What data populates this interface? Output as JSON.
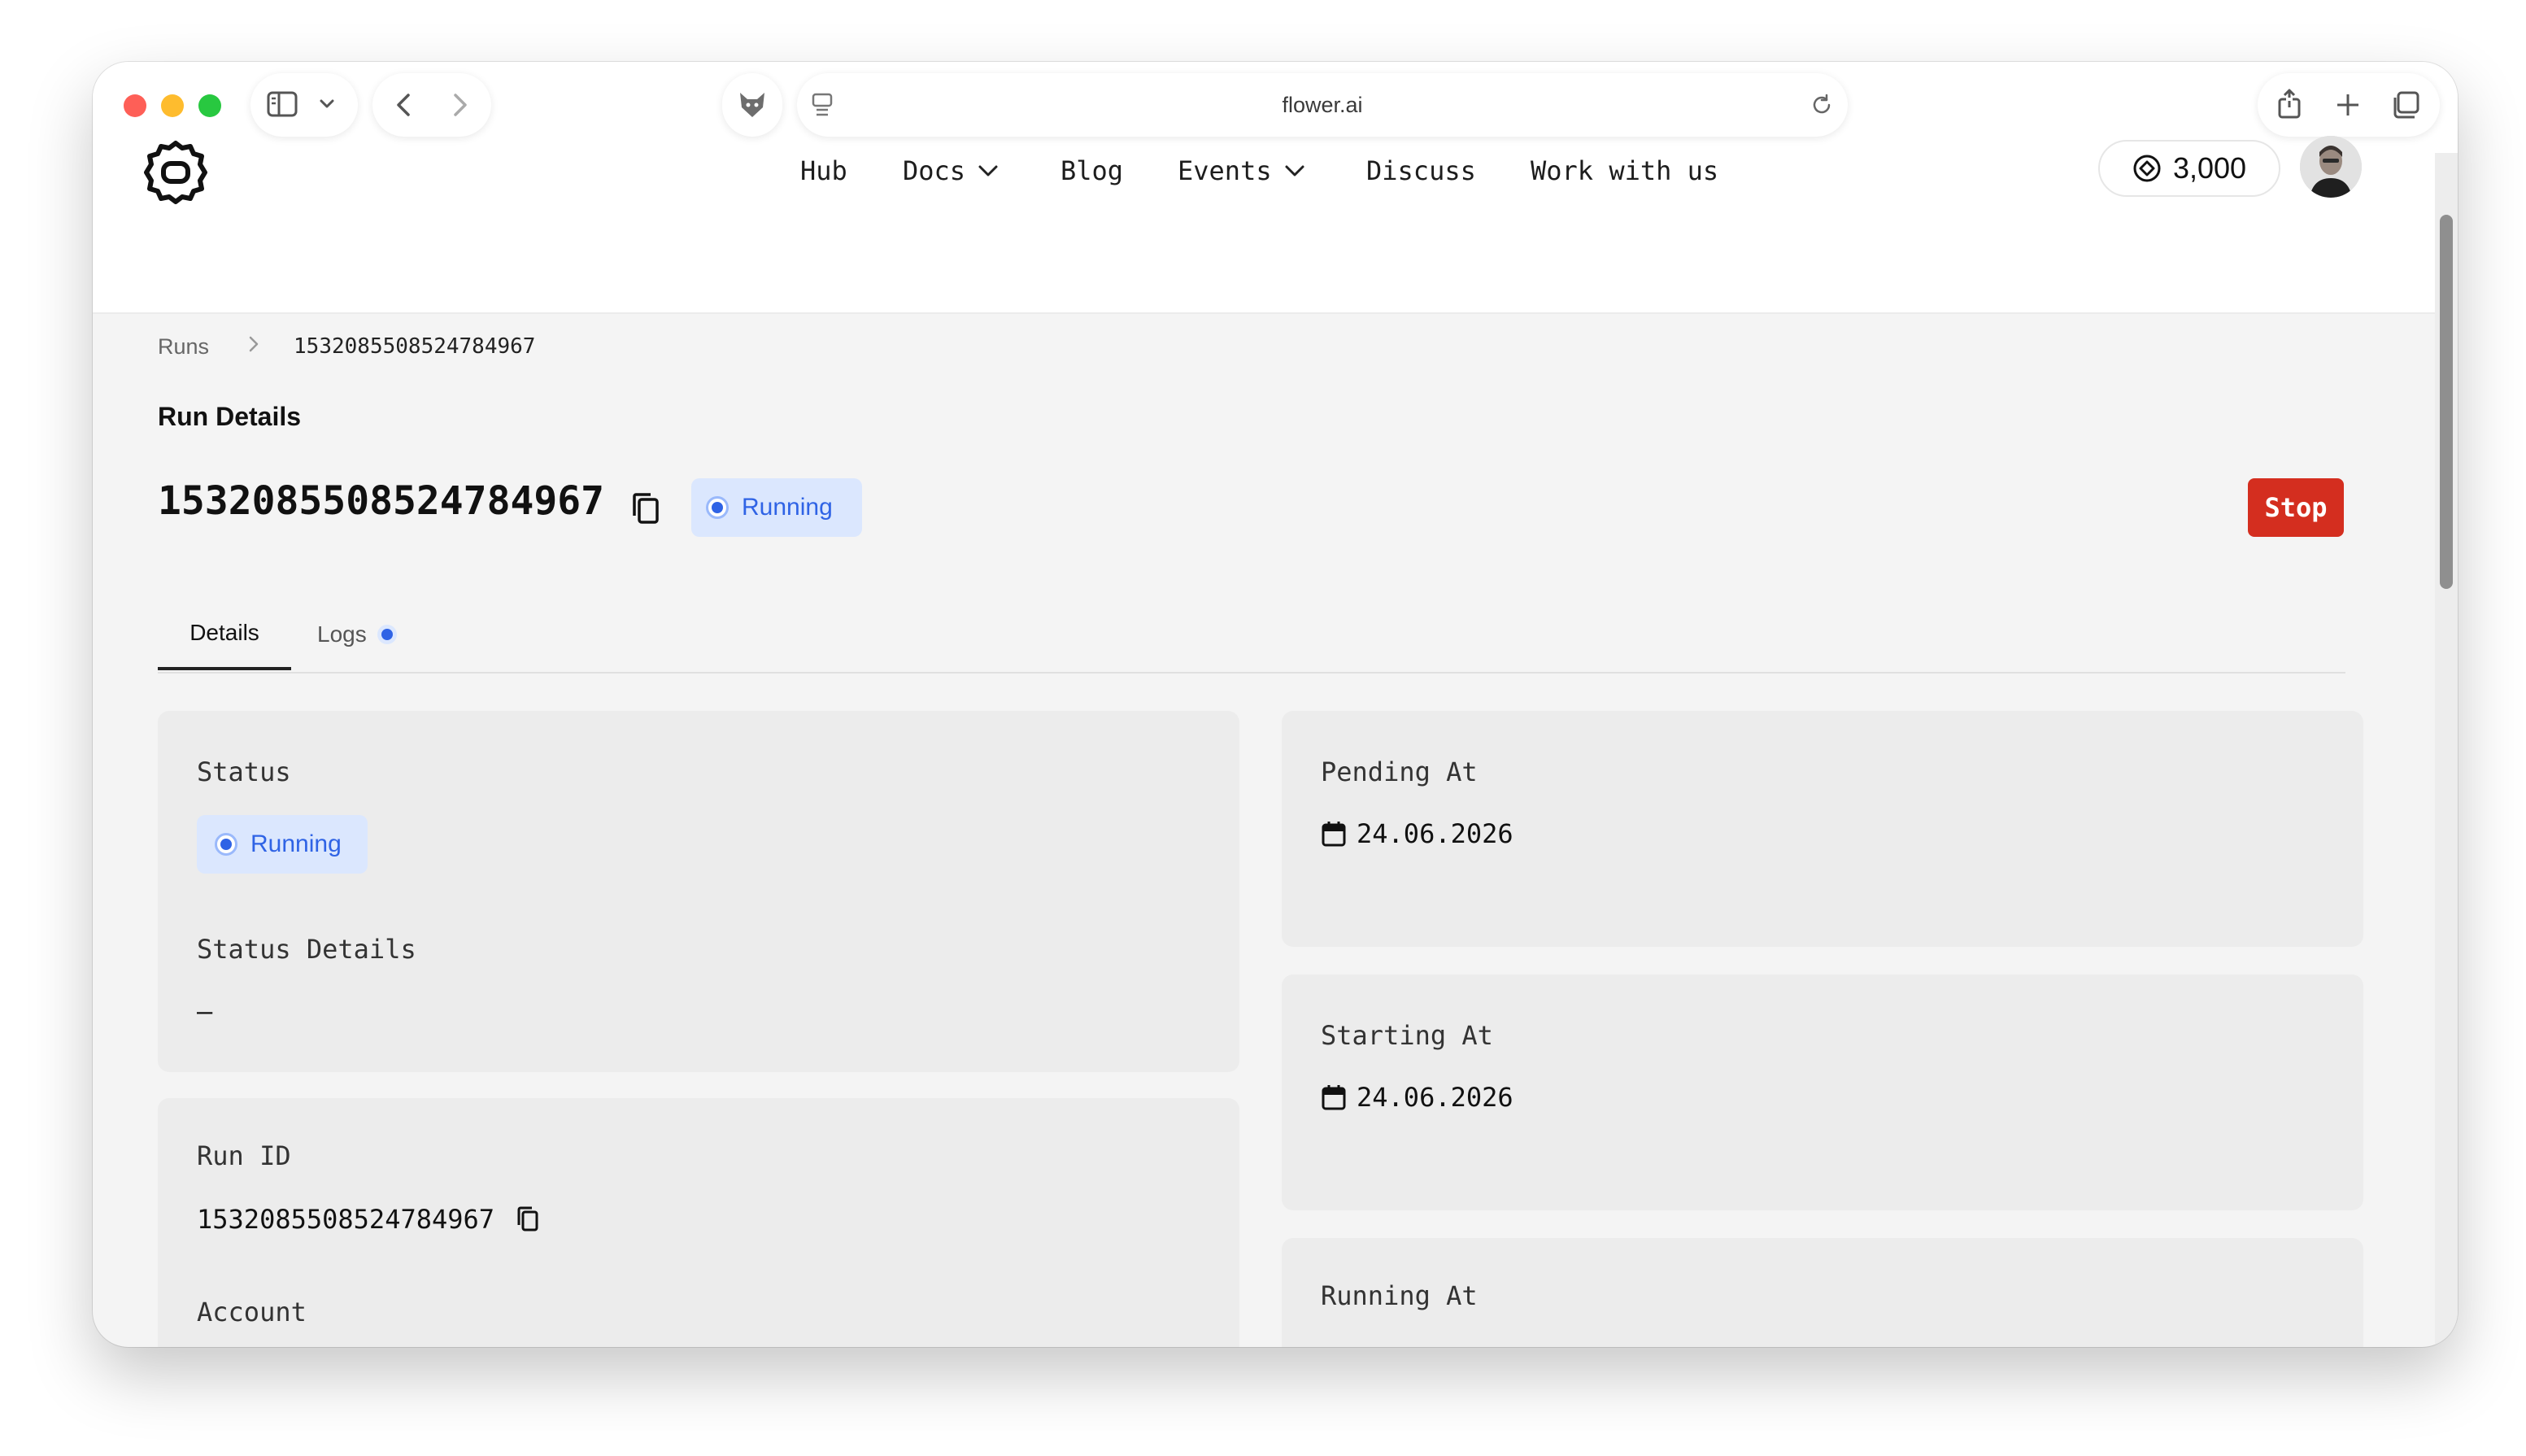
{
  "browser": {
    "url": "flower.ai"
  },
  "header": {
    "nav": {
      "hub": "Hub",
      "docs": "Docs",
      "blog": "Blog",
      "events": "Events",
      "discuss": "Discuss",
      "work": "Work with us"
    },
    "credits": "3,000"
  },
  "breadcrumb": {
    "root": "Runs",
    "current": "1532085508524784967"
  },
  "page": {
    "section_label": "Run Details",
    "run_id": "1532085508524784967",
    "status_badge": "Running",
    "stop_button": "Stop"
  },
  "tabs": {
    "details": "Details",
    "logs": "Logs"
  },
  "cards": {
    "status": {
      "label": "Status",
      "value": "Running",
      "details_label": "Status Details",
      "details_value": "–"
    },
    "run": {
      "id_label": "Run ID",
      "id_value": "1532085508524784967",
      "account_label": "Account"
    },
    "pending": {
      "label": "Pending At",
      "value": "24.06.2026"
    },
    "starting": {
      "label": "Starting At",
      "value": "24.06.2026"
    },
    "running": {
      "label": "Running At"
    }
  },
  "colors": {
    "accent_blue": "#2f63e5",
    "badge_bg": "#dbe7fe",
    "stop_red": "#d42e1f"
  },
  "icons": [
    "sidebar-icon",
    "chevron-down-icon",
    "back-arrow-icon",
    "forward-arrow-icon",
    "fox-icon",
    "page-icon",
    "reload-icon",
    "share-icon",
    "plus-icon",
    "tabs-icon",
    "flower-logo-icon",
    "coin-icon",
    "copy-icon",
    "calendar-icon",
    "chevron-right-icon"
  ]
}
